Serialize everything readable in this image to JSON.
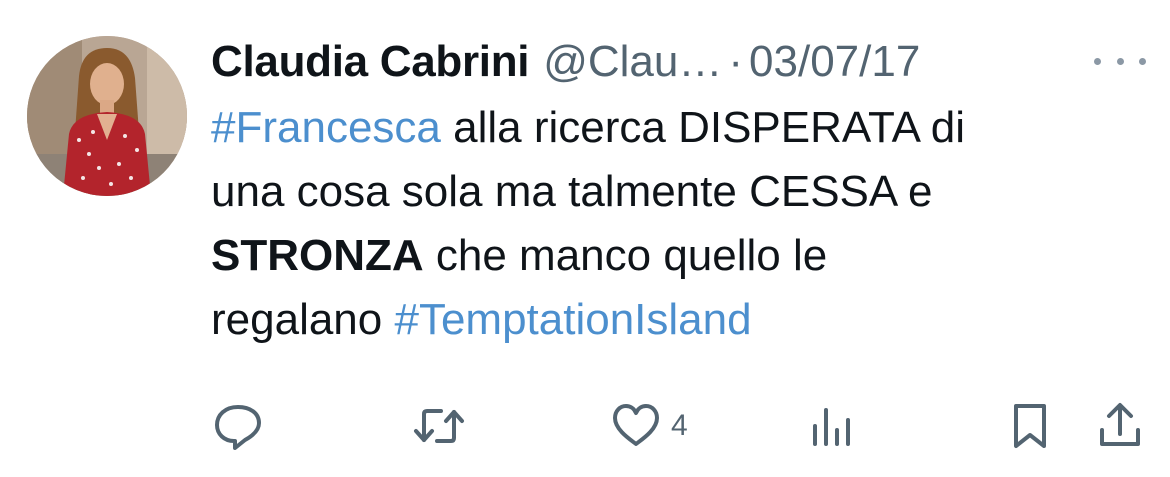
{
  "tweet": {
    "author_name": "Claudia Cabrini",
    "handle": "@Clau…",
    "separator": "·",
    "date": "03/07/17",
    "more_icon": "more-horizontal-icon",
    "body": {
      "line1": {
        "hashtag": "#Francesca",
        "text": " alla ricerca DISPERATA di"
      },
      "line2": {
        "text": "una cosa sola ma talmente CESSA e"
      },
      "line3": {
        "bold": "STRONZA",
        "text": " che manco quello le"
      },
      "line4": {
        "text": "regalano ",
        "hashtag": "#TemptationIsland"
      }
    },
    "actions": {
      "reply_icon": "reply-icon",
      "retweet_icon": "retweet-icon",
      "like_icon": "heart-icon",
      "like_count": "4",
      "views_icon": "views-icon",
      "bookmark_icon": "bookmark-icon",
      "share_icon": "share-icon"
    },
    "colors": {
      "hashtag": "#4c8fce",
      "secondary_text": "#536471",
      "icon": "#536471"
    }
  }
}
